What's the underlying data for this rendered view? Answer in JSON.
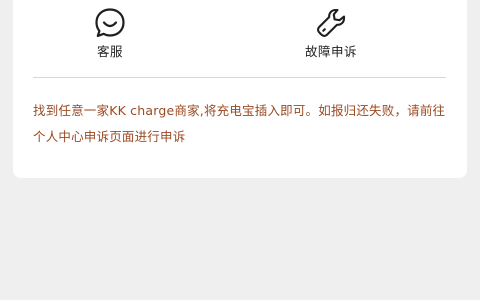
{
  "actions": {
    "customer_service": {
      "label": "客服",
      "icon": "smile-face-icon"
    },
    "fault_report": {
      "label": "故障申诉",
      "icon": "wrench-icon"
    }
  },
  "notice": {
    "text": "找到任意一家KK charge商家,将充电宝插入即可。如报归还失败，请前往个人中心申诉页面进行申诉",
    "color": "#9b4a22"
  }
}
